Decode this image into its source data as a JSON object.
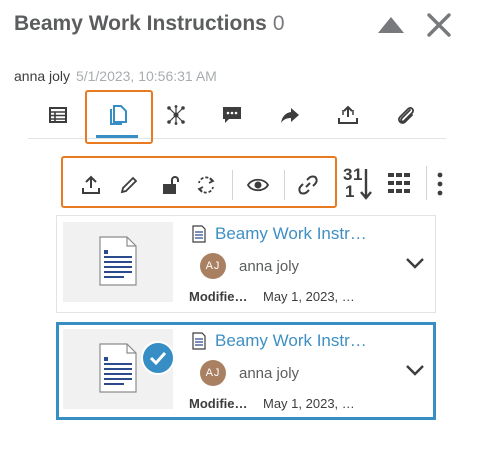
{
  "header": {
    "title": "Beamy Work Instructions",
    "count": "0",
    "collapse_icon": "triangle-up-icon",
    "close_icon": "close-icon"
  },
  "meta": {
    "user": "anna joly",
    "date": "5/1/2023, 10:56:31 AM"
  },
  "tabs": [
    {
      "name": "properties",
      "icon": "table-icon",
      "active": false
    },
    {
      "name": "documents",
      "icon": "document-icon",
      "active": true
    },
    {
      "name": "relations",
      "icon": "network-icon",
      "active": false
    },
    {
      "name": "comments",
      "icon": "comment-icon",
      "active": false
    },
    {
      "name": "share",
      "icon": "share-icon",
      "active": false
    },
    {
      "name": "upload",
      "icon": "upload-tray-icon",
      "active": false
    },
    {
      "name": "attachments",
      "icon": "paperclip-icon",
      "active": false
    }
  ],
  "toolbar": {
    "buttons": [
      "upload-icon",
      "edit-icon",
      "unlock-icon",
      "refresh-icon",
      "view-icon",
      "link-icon"
    ],
    "sort_label_top": "3",
    "sort_label_mid": "1",
    "sort_label_bottom": "1",
    "grid_icon": "grid-icon",
    "more_icon": "more-vertical-icon"
  },
  "documents": [
    {
      "title": "Beamy Work Instr…",
      "owner": "anna joly",
      "owner_initials": "AJ",
      "modified_label": "Modifie…",
      "modified_value": "May 1, 2023, …",
      "selected": false
    },
    {
      "title": "Beamy Work Instr…",
      "owner": "anna joly",
      "owner_initials": "AJ",
      "modified_label": "Modifie…",
      "modified_value": "May 1, 2023, …",
      "selected": true
    }
  ],
  "colors": {
    "accent": "#368ec4",
    "highlight": "#e87b21",
    "avatar": "#a98162"
  }
}
